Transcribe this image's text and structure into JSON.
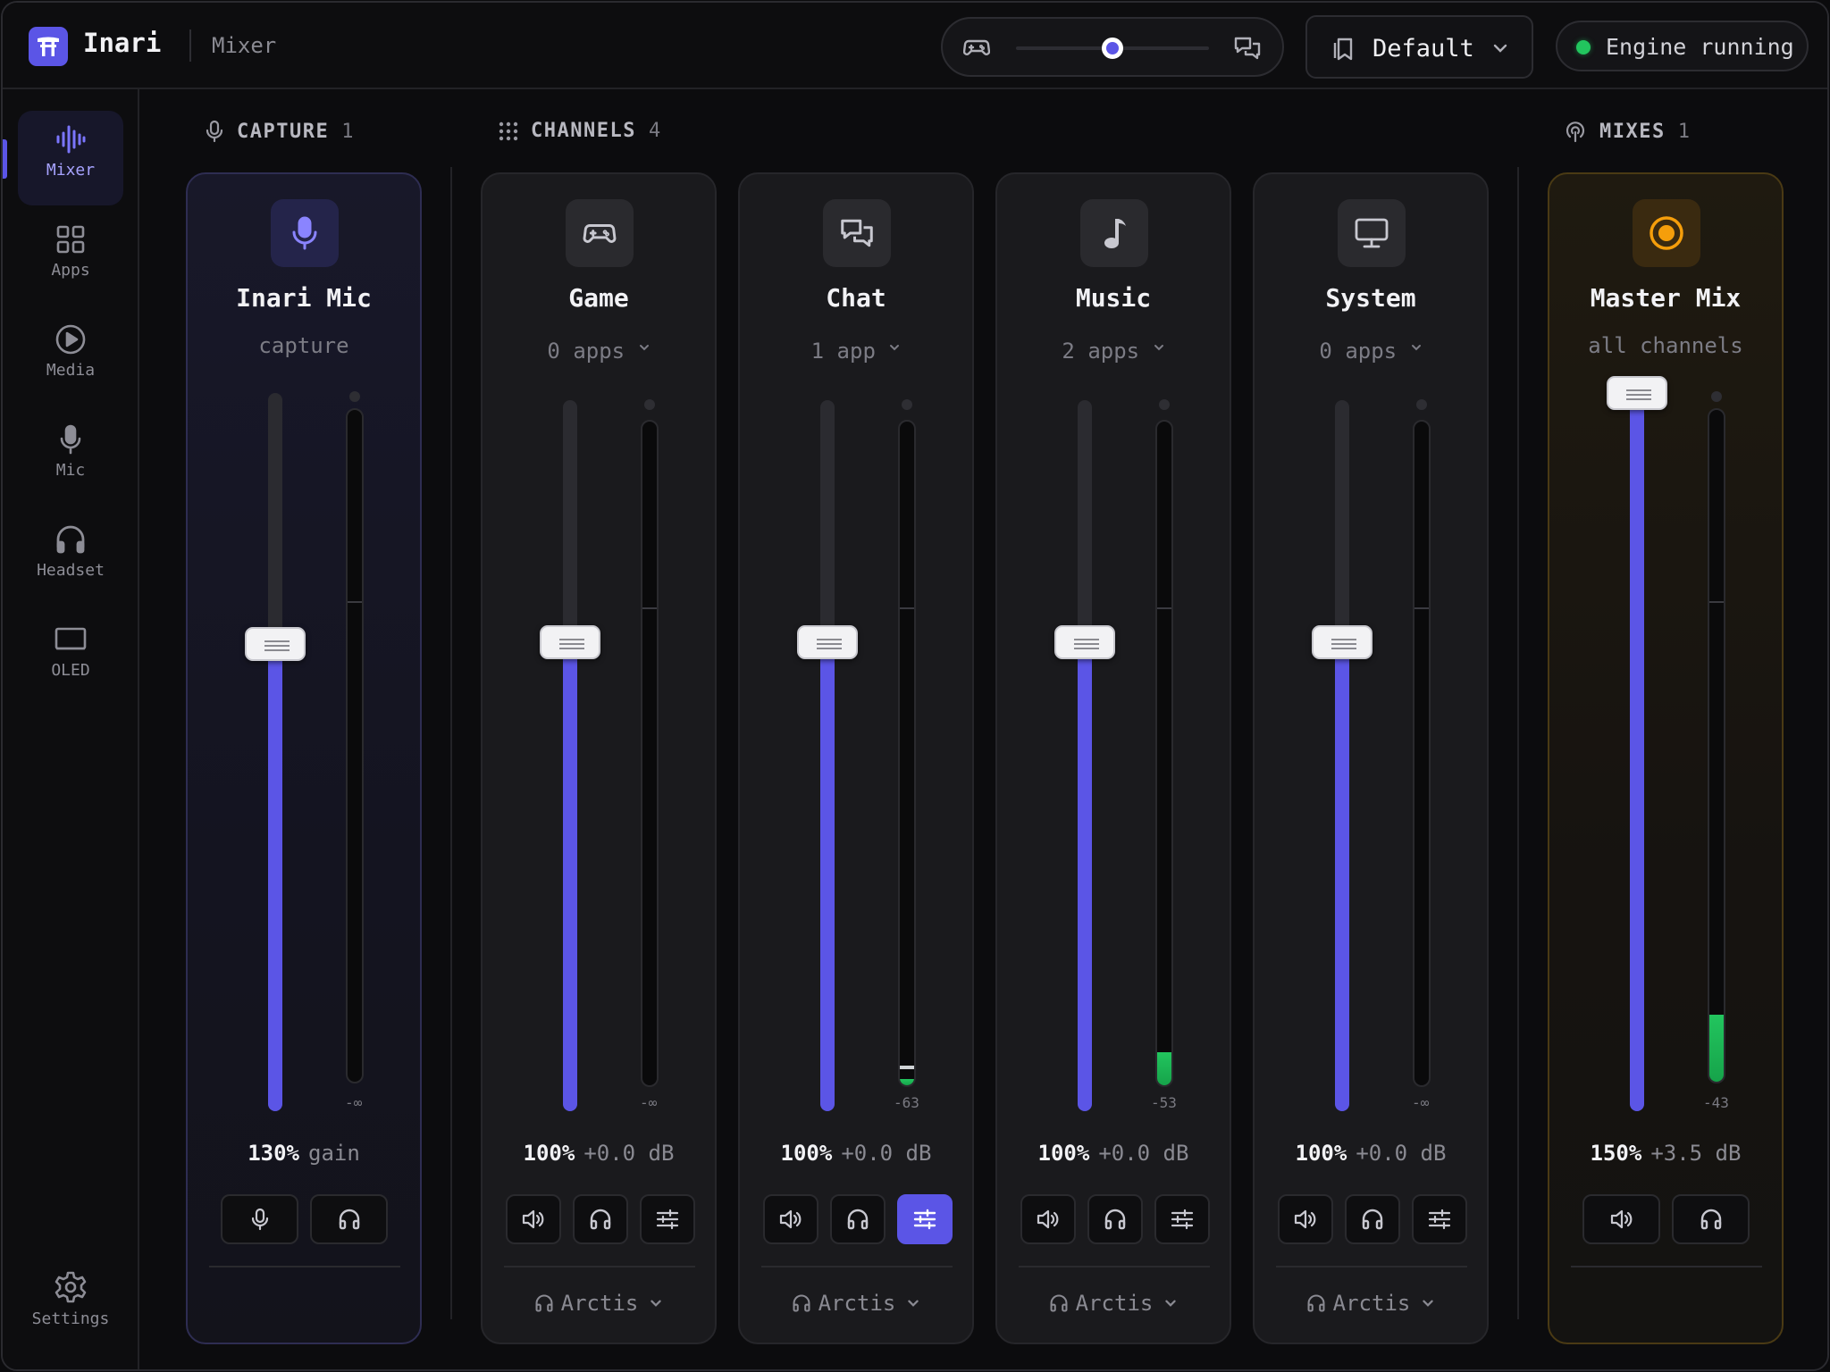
{
  "app": {
    "name": "Inari",
    "breadcrumb": "Mixer"
  },
  "balance": {
    "left_icon": "gamepad-icon",
    "right_icon": "chat-icon",
    "value": 0.5
  },
  "preset": {
    "label": "Default",
    "icon": "bookmark-icon"
  },
  "status": {
    "label": "Engine running",
    "color": "#22c55e"
  },
  "sidebar": {
    "items": [
      {
        "label": "Mixer",
        "icon": "waveform-icon",
        "active": true
      },
      {
        "label": "Apps",
        "icon": "grid-icon"
      },
      {
        "label": "Media",
        "icon": "play-circle-icon"
      },
      {
        "label": "Mic",
        "icon": "mic-icon"
      },
      {
        "label": "Headset",
        "icon": "headphones-icon"
      },
      {
        "label": "OLED",
        "icon": "screen-icon"
      }
    ],
    "settings_label": "Settings"
  },
  "sections": {
    "capture": {
      "title": "CAPTURE",
      "count": "1"
    },
    "channels": {
      "title": "CHANNELS",
      "count": "4"
    },
    "mixes": {
      "title": "MIXES",
      "count": "1"
    }
  },
  "capture": {
    "name": "Inari Mic",
    "sub": "capture",
    "percent": "130%",
    "unit": "gain",
    "fader": 0.65,
    "meter_label": "-∞",
    "meter_level": 0
  },
  "channels": [
    {
      "name": "Game",
      "apps": "0 apps",
      "icon": "gamepad-icon",
      "percent": "100%",
      "db": "+0.0 dB",
      "fader": 0.66,
      "meter_label": "-∞",
      "meter_level": 0,
      "output": "Arctis",
      "eq_active": false
    },
    {
      "name": "Chat",
      "apps": "1 app",
      "icon": "chat-icon",
      "percent": "100%",
      "db": "+0.0 dB",
      "fader": 0.66,
      "meter_label": "-63",
      "meter_level": 0.01,
      "output": "Arctis",
      "eq_active": true
    },
    {
      "name": "Music",
      "apps": "2 apps",
      "icon": "music-note-icon",
      "percent": "100%",
      "db": "+0.0 dB",
      "fader": 0.66,
      "meter_label": "-53",
      "meter_level": 0.05,
      "output": "Arctis",
      "eq_active": false
    },
    {
      "name": "System",
      "apps": "0 apps",
      "icon": "monitor-icon",
      "percent": "100%",
      "db": "+0.0 dB",
      "fader": 0.66,
      "meter_label": "-∞",
      "meter_level": 0,
      "output": "Arctis",
      "eq_active": false
    }
  ],
  "mix": {
    "name": "Master Mix",
    "sub": "all channels",
    "percent": "150%",
    "db": "+3.5 dB",
    "fader": 1.0,
    "meter_label": "-43",
    "meter_level": 0.1,
    "accent": "#f59e0b"
  },
  "colors": {
    "accent": "#5b55e6",
    "meter": "#22c55e"
  }
}
